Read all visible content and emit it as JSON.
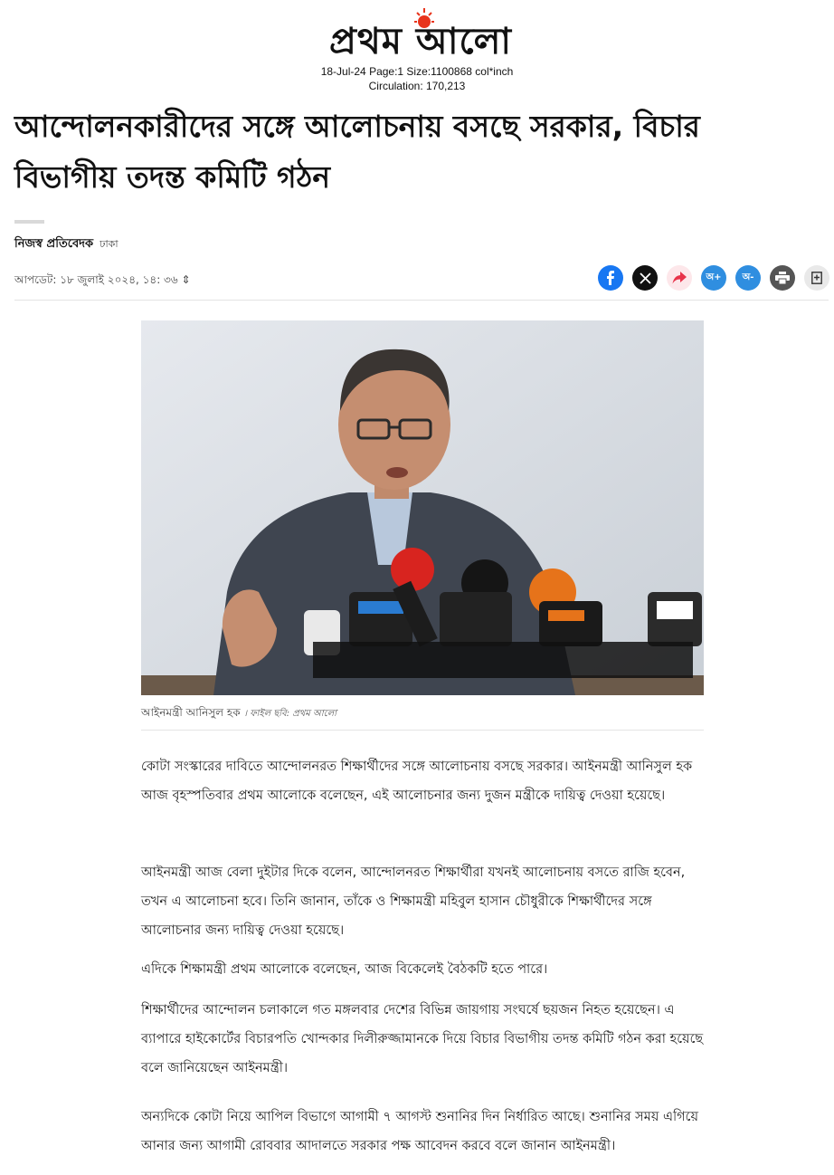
{
  "masthead": {
    "logo_text": "প্রথম আলো",
    "clip_info": "18-Jul-24 Page:1 Size:1100868 col*inch",
    "circulation": "Circulation: 170,213",
    "sun_color": "#e8341c"
  },
  "article": {
    "headline": "আন্দোলনকারীদের সঙ্গে আলোচনায় বসছে সরকার, বিচার বিভাগীয় তদন্ত কমিটি গঠন",
    "author": "নিজস্ব প্রতিবেদক",
    "location": "ঢাকা",
    "updated": "আপডেট: ১৮ জুলাই ২০২৪, ১৪: ৩৬ ⇕",
    "photo_caption": "আইনমন্ত্রী আনিসুল হক",
    "photo_credit": "। ফাইল ছবি: প্রথম আলো",
    "paragraphs": [
      "কোটা সংস্কারের দাবিতে আন্দোলনরত শিক্ষার্থীদের সঙ্গে আলোচনায় বসছে সরকার। আইনমন্ত্রী আনিসুল হক আজ বৃহস্পতিবার প্রথম আলোকে বলেছেন, এই আলোচনার জন্য দুজন মন্ত্রীকে দায়িত্ব দেওয়া হয়েছে।",
      "আইনমন্ত্রী আজ বেলা দুইটার দিকে বলেন, আন্দোলনরত শিক্ষার্থীরা যখনই আলোচনায় বসতে রাজি হবেন, তখন এ আলোচনা হবে। তিনি জানান, তাঁকে ও শিক্ষামন্ত্রী মহিবুল হাসান চৌধুরীকে শিক্ষার্থীদের সঙ্গে আলোচনার জন্য দায়িত্ব দেওয়া হয়েছে।",
      "এদিকে শিক্ষামন্ত্রী প্রথম আলোকে বলেছেন, আজ বিকেলেই বৈঠকটি হতে পারে।",
      "শিক্ষার্থীদের আন্দোলন চলাকালে গত মঙ্গলবার দেশের বিভিন্ন জায়গায় সংঘর্ষে ছয়জন নিহত হয়েছেন। এ ব্যাপারে হাইকোর্টের বিচারপতি খোন্দকার দিলীরুজ্জামানকে দিয়ে বিচার বিভাগীয় তদন্ত কমিটি গঠন করা হয়েছে বলে জানিয়েছেন আইনমন্ত্রী।",
      "অন্যদিকে কোটা নিয়ে আপিল বিভাগে আগামী ৭ আগস্ট শুনানির দিন নির্ধারিত আছে। শুনানির সময় এগিয়ে আনার জন্য আগামী রোববার আদালতে সরকার পক্ষ আবেদন করবে বলে জানান আইনমন্ত্রী।"
    ]
  },
  "share_bar": {
    "font_increase": "অ+",
    "font_decrease": "অ-",
    "colors": {
      "facebook": "#1877f2",
      "x": "#111111",
      "share": "#fde7ea",
      "share_arrow": "#e8334a",
      "font": "#2f8ee0",
      "print": "#555555",
      "bookmark": "#e9e9e9"
    }
  }
}
